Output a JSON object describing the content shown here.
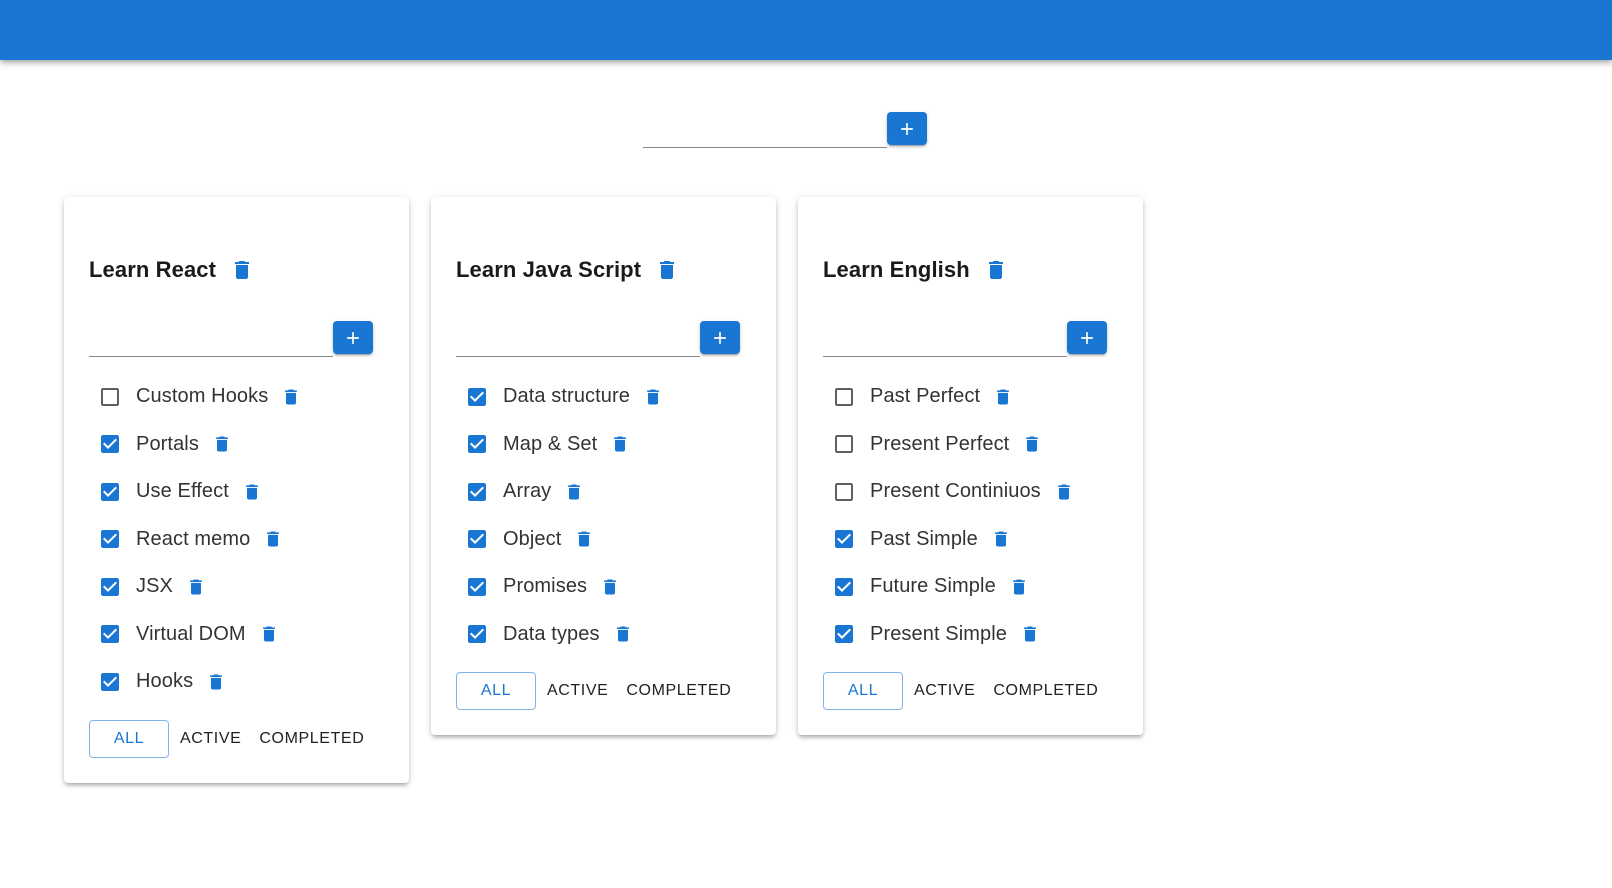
{
  "header": {
    "color": "#1976d2"
  },
  "new_list": {
    "input_value": "",
    "add_icon": "plus-icon"
  },
  "lists": [
    {
      "title": "Learn React",
      "input_value": "",
      "tasks": [
        {
          "label": "Custom Hooks",
          "checked": false
        },
        {
          "label": "Portals",
          "checked": true
        },
        {
          "label": "Use Effect",
          "checked": true
        },
        {
          "label": "React memo",
          "checked": true
        },
        {
          "label": "JSX",
          "checked": true
        },
        {
          "label": "Virtual DOM",
          "checked": true
        },
        {
          "label": "Hooks",
          "checked": true
        }
      ],
      "filters": [
        "ALL",
        "ACTIVE",
        "COMPLETED"
      ],
      "active_filter": "ALL"
    },
    {
      "title": "Learn Java Script",
      "input_value": "",
      "tasks": [
        {
          "label": "Data structure",
          "checked": true
        },
        {
          "label": "Map & Set",
          "checked": true
        },
        {
          "label": "Array",
          "checked": true
        },
        {
          "label": "Object",
          "checked": true
        },
        {
          "label": "Promises",
          "checked": true
        },
        {
          "label": "Data types",
          "checked": true
        }
      ],
      "filters": [
        "ALL",
        "ACTIVE",
        "COMPLETED"
      ],
      "active_filter": "ALL"
    },
    {
      "title": "Learn English",
      "input_value": "",
      "tasks": [
        {
          "label": "Past Perfect",
          "checked": false
        },
        {
          "label": "Present Perfect",
          "checked": false
        },
        {
          "label": "Present Continiuos",
          "checked": false
        },
        {
          "label": "Past Simple",
          "checked": true
        },
        {
          "label": "Future Simple",
          "checked": true
        },
        {
          "label": "Present Simple",
          "checked": true
        }
      ],
      "filters": [
        "ALL",
        "ACTIVE",
        "COMPLETED"
      ],
      "active_filter": "ALL"
    }
  ]
}
